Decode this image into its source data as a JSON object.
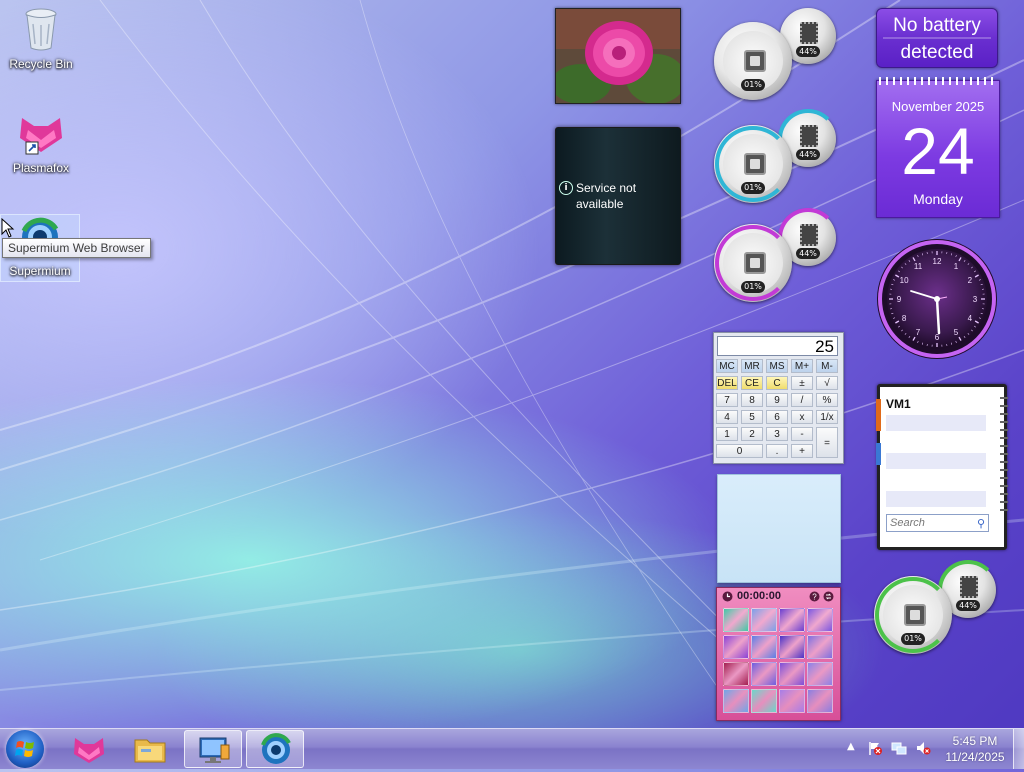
{
  "desktop": {
    "icons": [
      {
        "label": "Recycle Bin",
        "icon": "recycle-bin-icon"
      },
      {
        "label": "Plasmafox",
        "icon": "plasmafox-icon"
      },
      {
        "label": "Supermium",
        "icon": "supermium-icon"
      }
    ],
    "tooltip": "Supermium Web Browser"
  },
  "gadgets": {
    "feed": {
      "message": "Service not available"
    },
    "meters": [
      {
        "cpu": "01%",
        "memory": "44%",
        "accent": "#9a9a9a"
      },
      {
        "cpu": "01%",
        "memory": "44%",
        "accent": "#2fb6d6"
      },
      {
        "cpu": "01%",
        "memory": "44%",
        "accent": "#c23ad6"
      },
      {
        "cpu": "01%",
        "memory": "44%",
        "accent": "#4cc24a"
      }
    ],
    "battery": {
      "line1": "No battery",
      "line2": "detected"
    },
    "calendar": {
      "month": "November 2025",
      "day": "24",
      "weekday": "Monday"
    },
    "clock": {
      "numbers": [
        "12",
        "1",
        "2",
        "3",
        "4",
        "5",
        "6",
        "7",
        "8",
        "9",
        "10",
        "11"
      ],
      "accent": "#b04be8"
    },
    "calculator": {
      "display": "25",
      "keys": [
        "MC",
        "MR",
        "MS",
        "M+",
        "M-",
        "DEL",
        "CE",
        "C",
        "±",
        "√",
        "7",
        "8",
        "9",
        "/",
        "%",
        "4",
        "5",
        "6",
        "x",
        "1/x",
        "1",
        "2",
        "3",
        "-",
        "=",
        "0",
        ".",
        "+"
      ]
    },
    "puzzle": {
      "timer": "00:00:00"
    },
    "contacts": {
      "group": "VM1",
      "search_placeholder": "Search"
    }
  },
  "taskbar": {
    "clock_time": "5:45 PM",
    "clock_date": "11/24/2025",
    "pinned": [
      "plasmafox-icon",
      "file-explorer-icon",
      "remote-desktop-icon",
      "supermium-icon"
    ],
    "active_index": 2
  }
}
